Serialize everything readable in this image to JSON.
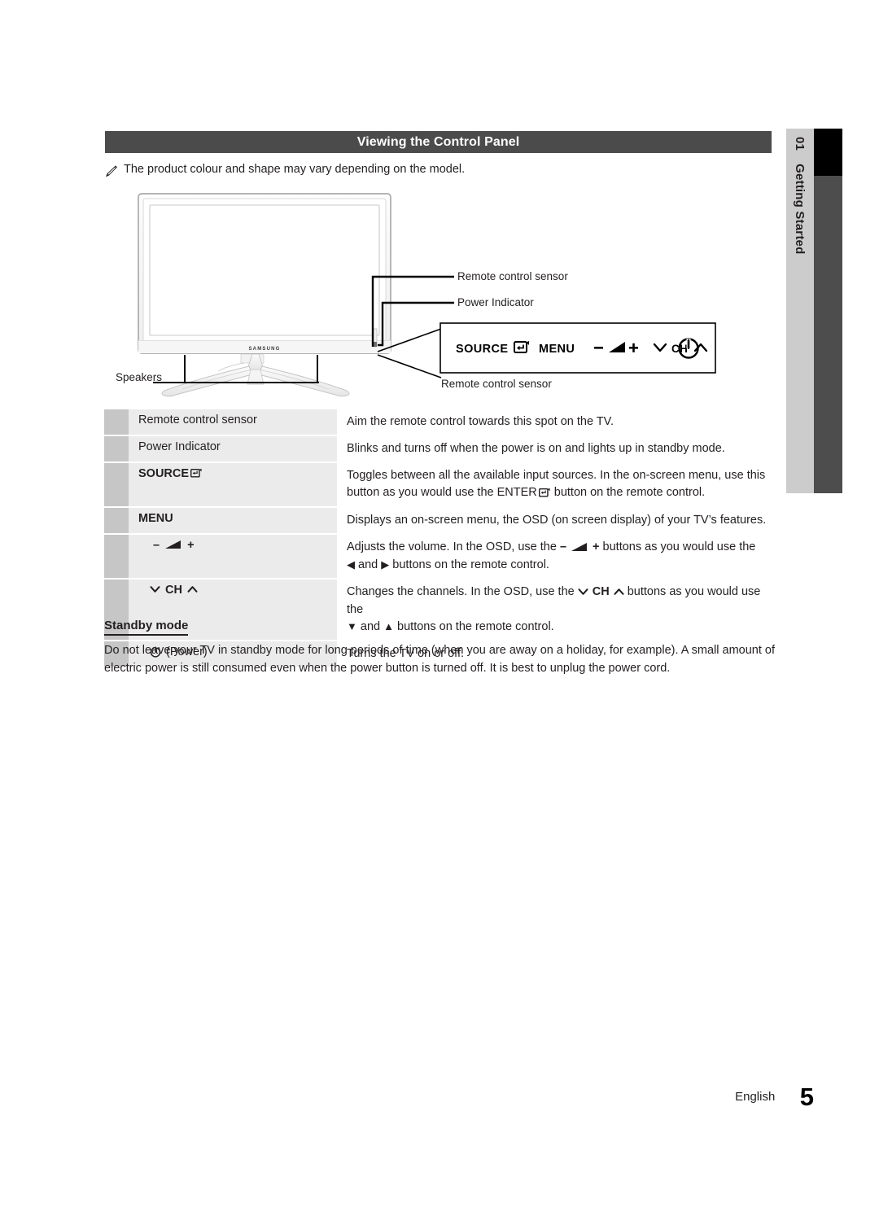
{
  "chapter_tab": {
    "number": "01",
    "label": "Getting Started"
  },
  "section": {
    "title": "Viewing the Control Panel"
  },
  "note": {
    "icon": "pencil-icon",
    "text": "The product colour and shape may vary depending on the model."
  },
  "illustration": {
    "brand": "SAMSUNG",
    "callouts": {
      "remote_sensor_top": "Remote control sensor",
      "power_indicator": "Power Indicator",
      "speakers": "Speakers",
      "remote_sensor_bottom": "Remote control sensor"
    },
    "control_panel": {
      "source_label": "SOURCE",
      "source_icon": "enter-icon",
      "menu_label": "MENU",
      "volume_minus": "–",
      "volume_icon": "volume-icon",
      "volume_plus": "+",
      "ch_down_icon": "chevron-down-icon",
      "ch_label": "CH",
      "ch_up_icon": "chevron-up-icon",
      "power_icon": "power-icon"
    }
  },
  "table": {
    "rows": [
      {
        "label": "Remote control sensor",
        "bold": false,
        "desc_lines": [
          "Aim the remote control towards this spot on the TV."
        ]
      },
      {
        "label": "Power Indicator",
        "bold": false,
        "desc_lines": [
          "Blinks and turns off when the power is on and lights up in standby mode."
        ]
      },
      {
        "label": "SOURCE",
        "label_icon": "enter-icon",
        "bold": true,
        "desc_lines": [
          "Toggles between all the available input sources. In the on-screen menu, use this",
          "button as you would use the ENTER",
          " button on the remote control."
        ]
      },
      {
        "label": "MENU",
        "bold": true,
        "desc_lines": [
          "Displays an on-screen menu, the OSD (on screen display) of your TV’s features."
        ]
      },
      {
        "label_parts": {
          "minus": "–",
          "icon": "volume-icon",
          "plus": "+"
        },
        "bold": true,
        "desc_lines": [
          "Adjusts the volume. In the OSD, use the",
          "buttons as you would use the",
          "and",
          "buttons on the remote control."
        ]
      },
      {
        "label_parts": {
          "down": "chevron-down-icon",
          "text": "CH",
          "up": "chevron-up-icon"
        },
        "bold": true,
        "desc_lines": [
          "Changes the channels. In the OSD, use the",
          "buttons as you would use the",
          "and",
          "buttons on the remote control."
        ]
      },
      {
        "label": "(Power)",
        "label_icon": "power-icon",
        "bold": false,
        "desc_lines": [
          "Turns the TV on or off."
        ]
      }
    ]
  },
  "standby": {
    "title": "Standby mode",
    "body": "Do not leave your TV in standby mode for long periods of time (when you are away on a holiday, for example). A small amount of electric power is still consumed even when the power button is turned off. It is best to unplug the power cord."
  },
  "footer": {
    "language": "English",
    "page": "5"
  },
  "colors": {
    "header_bar": "#4b4b4b",
    "chapter_tab": "#cccccc",
    "chapter_bar": "#4d4d4d",
    "chapter_active": "#000000",
    "row_label_bg": "#ebebeb",
    "row_icon_bg": "#c6c6c6",
    "text": "#231f20"
  }
}
